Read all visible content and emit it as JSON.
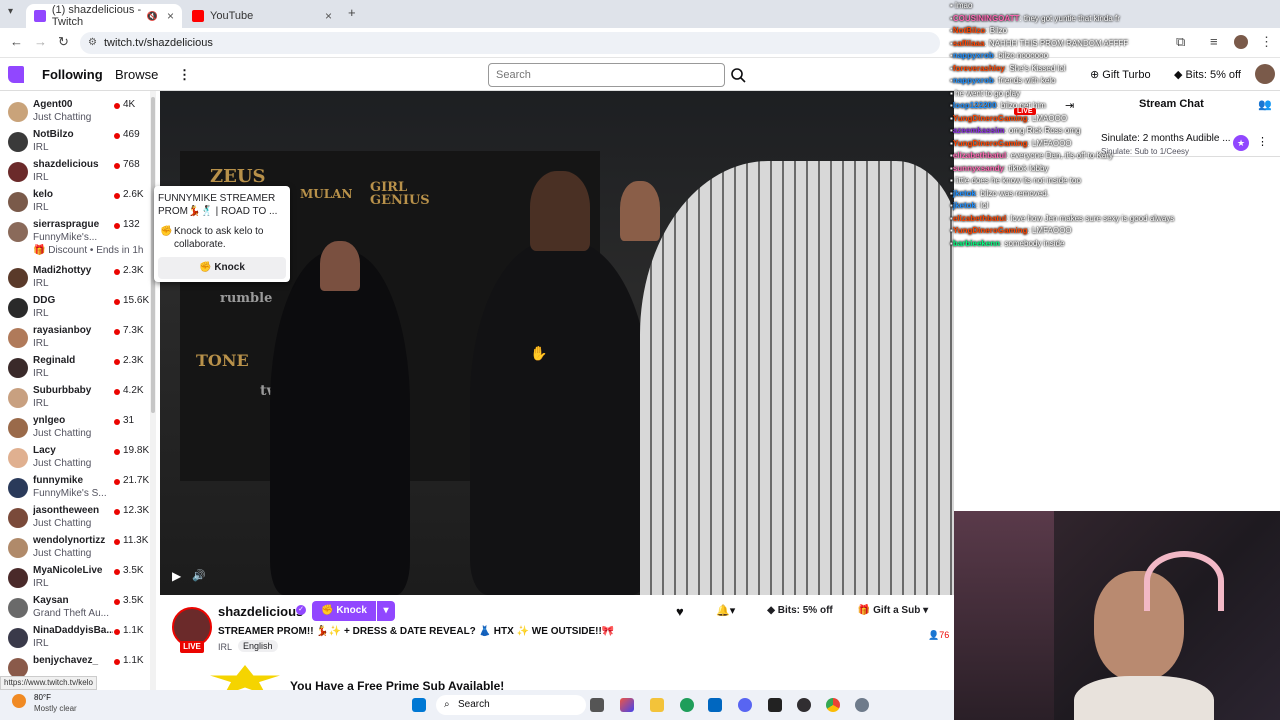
{
  "browser": {
    "tabs": [
      {
        "label": "(1) shazdelicious - Twitch",
        "active": true
      },
      {
        "label": "YouTube",
        "active": false
      }
    ],
    "url": "twitch.tv/shazdelicious",
    "status_url": "https://www.twitch.tv/kelo"
  },
  "twitch_header": {
    "following": "Following",
    "browse": "Browse",
    "search_placeholder": "Search",
    "gift_turbo": "Gift Turbo",
    "bits": "Bits: 5% off"
  },
  "sidebar": {
    "channels": [
      {
        "name": "Agent00",
        "category": "Just Chatting",
        "viewers": "4K"
      },
      {
        "name": "NotBilzo",
        "category": "IRL",
        "viewers": "469"
      },
      {
        "name": "shazdelicious",
        "category": "IRL",
        "viewers": "768"
      },
      {
        "name": "kelo",
        "category": "IRL",
        "viewers": "2.6K"
      },
      {
        "name": "sierrasprague",
        "category": "FunnyMike's...",
        "viewers": "132",
        "extra": "Discount • Ends in 1h"
      },
      {
        "name": "Madi2hottyy",
        "category": "IRL",
        "viewers": "2.3K"
      },
      {
        "name": "DDG",
        "category": "IRL",
        "viewers": "15.6K"
      },
      {
        "name": "rayasianboy",
        "category": "IRL",
        "viewers": "7.3K"
      },
      {
        "name": "Reginald",
        "category": "IRL",
        "viewers": "2.3K"
      },
      {
        "name": "Suburbbaby",
        "category": "IRL",
        "viewers": "4.2K"
      },
      {
        "name": "ynlgeo",
        "category": "Just Chatting",
        "viewers": "31"
      },
      {
        "name": "Lacy",
        "category": "Just Chatting",
        "viewers": "19.8K"
      },
      {
        "name": "funnymike",
        "category": "FunnyMike's S...",
        "viewers": "21.7K"
      },
      {
        "name": "jasontheween",
        "category": "Just Chatting",
        "viewers": "12.3K"
      },
      {
        "name": "wendolynortizz",
        "category": "Just Chatting",
        "viewers": "11.3K"
      },
      {
        "name": "MyaNicoleLive",
        "category": "IRL",
        "viewers": "3.5K"
      },
      {
        "name": "Kaysan",
        "category": "Grand Theft Au...",
        "viewers": "3.5K"
      },
      {
        "name": "NinaDaddyisBa...",
        "category": "IRL",
        "viewers": "1.1K"
      },
      {
        "name": "benjychavez_",
        "category": "",
        "viewers": "1.1K"
      }
    ]
  },
  "popup": {
    "title": "FUNNYMIKE STREAMER PROM💃🕺🏿 | ROAD TO ...",
    "knock_text": "Knock to ask kelo to collaborate.",
    "knock_button": "Knock"
  },
  "video": {
    "wall_words": [
      "ZEUS",
      "MULAN",
      "GIRL GENIUS",
      "TONE",
      "rumble",
      "twitch"
    ]
  },
  "stream_info": {
    "name": "shazdelicious",
    "knock": "Knock",
    "title": "STREAMER PROM!! 💃✨ + DRESS & DATE REVEAL? 👗 HTX ✨ WE OUTSIDE!!🎀",
    "tags": [
      "IRL",
      "English"
    ],
    "live": "LIVE",
    "bits": "Bits: 5% off",
    "gift_sub": "Gift a Sub",
    "viewers_partial": "76",
    "prime_text": "You Have a Free Prime Sub Available!"
  },
  "chat_panel": {
    "header": "Stream Chat",
    "pinned": "Sinulate: 2 months Audible ...",
    "pinned_sub": "Sinulate: Sub to 1/Ceesy",
    "live_label": "LIVE"
  },
  "chat_overlay": [
    {
      "user": "",
      "msg": "lmao"
    },
    {
      "user": "COUSININGOATT",
      "msg": "they got yuntie that kinda fr"
    },
    {
      "user": "NotBilzo",
      "msg": "Bilzo"
    },
    {
      "user": "saflilaaa",
      "msg": "NAHHH THIS PROM RANDOM AFFFF"
    },
    {
      "user": "nappyxrob",
      "msg": "bilzo noooooo"
    },
    {
      "user": "foreverashley",
      "msg": "She's Kissed lol"
    },
    {
      "user": "nappyxrob",
      "msg": "friends with kelo"
    },
    {
      "user": "",
      "msg": "he went to go play"
    },
    {
      "user": "loop122200",
      "msg": "bilzo get him"
    },
    {
      "user": "YungDineroGaming",
      "msg": "LMAOOO"
    },
    {
      "user": "azeemkassim",
      "msg": "omg Rick Ross omg"
    },
    {
      "user": "YungDineroGaming",
      "msg": "LMFAOOO"
    },
    {
      "user": "elizabethbatul",
      "msg": "everyone Dan, it's off to Kary"
    },
    {
      "user": "sunnyxsandy",
      "msg": "tiktok lobby"
    },
    {
      "user": "",
      "msg": "little does he know its not inside too"
    },
    {
      "user": "jketok",
      "msg": "bilzo was removed."
    },
    {
      "user": "jketok",
      "msg": "lol"
    },
    {
      "user": "elizabethbatul",
      "msg": "love how Jen makes sure sexy is good always"
    },
    {
      "user": "YungDineroGaming",
      "msg": "LMFAOOO"
    },
    {
      "user": "barbieekenn",
      "msg": "somebody inside"
    }
  ],
  "taskbar": {
    "weather_temp": "80°F",
    "weather_desc": "Mostly clear",
    "search": "Search"
  },
  "colors": {
    "twitch_purple": "#9147ff",
    "live_red": "#eb0400",
    "irl_green": "#00a35c"
  }
}
